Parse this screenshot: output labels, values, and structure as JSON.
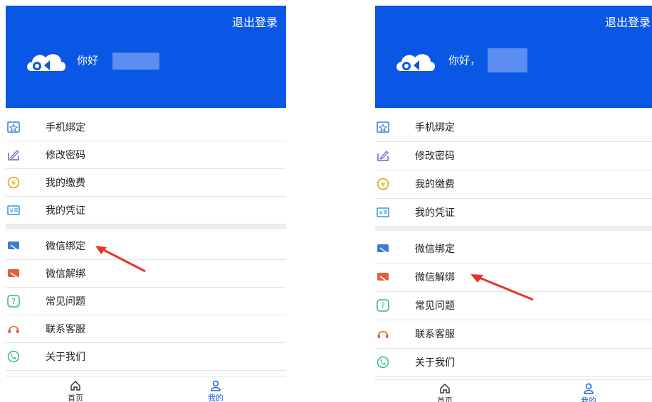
{
  "screens": [
    {
      "header": {
        "logout": "退出登录",
        "greeting": "你好"
      },
      "menu_group1": [
        {
          "label": "手机绑定",
          "icon": "phone-bind-icon"
        },
        {
          "label": "修改密码",
          "icon": "edit-password-icon"
        },
        {
          "label": "我的缴费",
          "icon": "payment-icon"
        },
        {
          "label": "我的凭证",
          "icon": "voucher-icon"
        }
      ],
      "menu_group2": [
        {
          "label": "微信绑定",
          "icon": "wechat-bind-icon"
        },
        {
          "label": "微信解绑",
          "icon": "wechat-unbind-icon"
        },
        {
          "label": "常见问题",
          "icon": "faq-icon"
        },
        {
          "label": "联系客服",
          "icon": "headset-icon"
        },
        {
          "label": "关于我们",
          "icon": "phone-call-icon"
        }
      ],
      "tabs": [
        {
          "label": "首页",
          "icon": "home-icon"
        },
        {
          "label": "我的",
          "icon": "user-icon",
          "active": true
        }
      ],
      "highlighted_item": "微信绑定"
    },
    {
      "header": {
        "logout": "退出登录",
        "greeting": "你好，"
      },
      "menu_group1": [
        {
          "label": "手机绑定",
          "icon": "phone-bind-icon"
        },
        {
          "label": "修改密码",
          "icon": "edit-password-icon"
        },
        {
          "label": "我的缴费",
          "icon": "payment-icon"
        },
        {
          "label": "我的凭证",
          "icon": "voucher-icon"
        }
      ],
      "menu_group2": [
        {
          "label": "微信绑定",
          "icon": "wechat-bind-icon"
        },
        {
          "label": "微信解绑",
          "icon": "wechat-unbind-icon"
        },
        {
          "label": "常见问题",
          "icon": "faq-icon"
        },
        {
          "label": "联系客服",
          "icon": "headset-icon"
        },
        {
          "label": "关于我们",
          "icon": "phone-call-icon"
        }
      ],
      "tabs": [
        {
          "label": "首页",
          "icon": "home-icon"
        },
        {
          "label": "我的",
          "icon": "user-icon",
          "active": true
        }
      ],
      "highlighted_item": "微信解绑"
    }
  ],
  "colors": {
    "header_blue": "#0a57e6",
    "active_tab": "#1a5fe0",
    "arrow_red": "#e8342a"
  }
}
